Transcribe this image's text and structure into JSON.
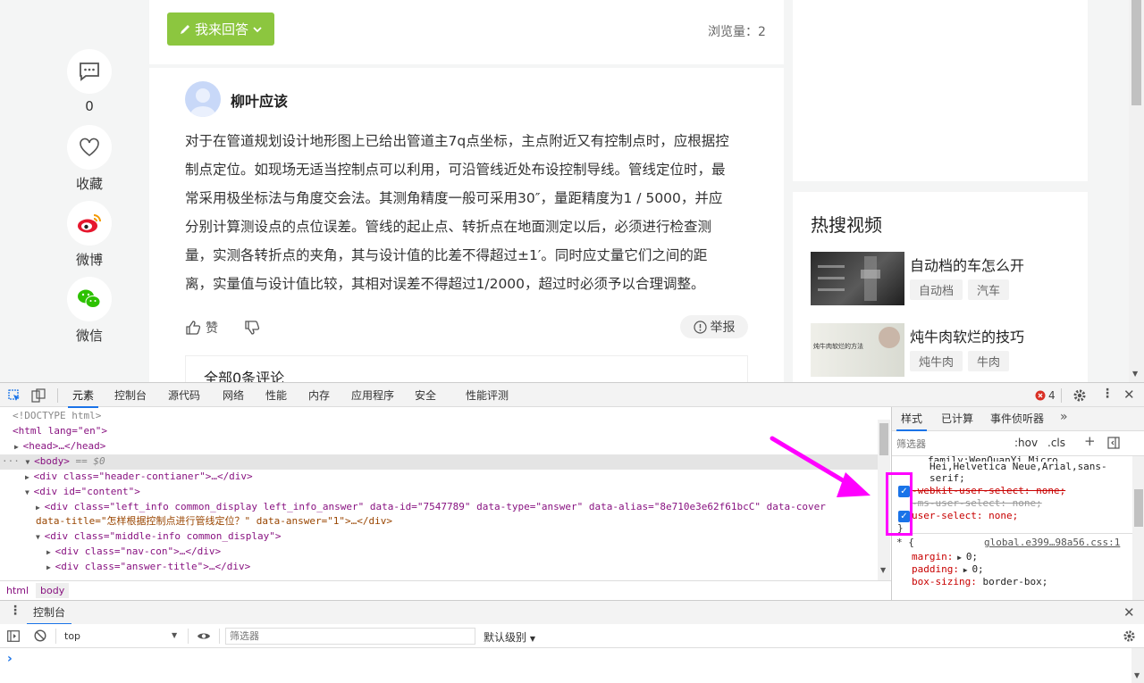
{
  "page": {
    "answer_button": "我来回答",
    "views_label": "浏览量：2",
    "side": {
      "comment_count": "0",
      "favorite": "收藏",
      "weibo": "微博",
      "wechat": "微信"
    },
    "author": "柳叶应该",
    "answer_lines": [
      "对于在管道规划设计地形图上已给出管道主7q点坐标，主点附近又有控制点时，应根据控",
      "制点定位。如现场无适当控制点可以利用，可沿管线近处布设控制导线。管线定位时，最",
      "常采用极坐标法与角度交会法。其测角精度一般可采用30″，量距精度为1 / 5000，并应",
      "分别计算测设点的点位误差。管线的起止点、转折点在地面测定以后，必须进行检查测",
      "量，实测各转折点的夹角，其与设计值的比差不得超过±1′。同时应丈量它们之间的距",
      "离，实量值与设计值比较，其相对误差不得超过1/2000，超过时必须予以合理调整。"
    ],
    "like": "赞",
    "report": "举报",
    "comments_title": "全部0条评论",
    "hot_title": "热搜视频",
    "videos": [
      {
        "title": "自动档的车怎么开",
        "tags": [
          "自动档",
          "汽车"
        ]
      },
      {
        "title": "炖牛肉软烂的技巧",
        "tags": [
          "炖牛肉",
          "牛肉"
        ],
        "thumb_text": "炖牛肉软烂的方法"
      }
    ]
  },
  "devtools": {
    "tabs": [
      "元素",
      "控制台",
      "源代码",
      "网络",
      "性能",
      "内存",
      "应用程序",
      "安全",
      "性能评测"
    ],
    "error_count": "4",
    "elements": {
      "doctype": "<!DOCTYPE html>",
      "html_open": "<html lang=\"en\">",
      "head": "<head>…</head>",
      "body": "<body>",
      "body_suffix": "== $0",
      "header_div": "<div class=\"header-contianer\">…</div>",
      "content_div": "<div id=\"content\">",
      "left_info_1": "<div class=\"left_info common_display left_info_answer\" data-id=\"7547789\" data-type=\"answer\" data-alias=\"8e710e3e62f61bcC\" data-cover",
      "left_info_2": "data-title=\"怎样根据控制点进行管线定位？\" data-answer=\"1\">…</div>",
      "middle_info": "<div class=\"middle-info common_display\">",
      "nav_con": "<div class=\"nav-con\">…</div>",
      "answer_title": "<div class=\"answer-title\">…</div>"
    },
    "breadcrumb": [
      "html",
      "body"
    ],
    "styles": {
      "tabs": [
        "样式",
        "已计算",
        "事件侦听器"
      ],
      "filter_placeholder": "筛选器",
      "hov": ":hov",
      "cls": ".cls",
      "font_partial": "family:WenQuanYi Micro",
      "font_line1": "Hei,Helvetica Neue,Arial,sans-",
      "font_line2": "serif;",
      "prop1": "-webkit-user-select: none;",
      "prop2": "-ms-user-select: none;",
      "prop3": "user-select: none;",
      "close_brace": "}",
      "rule_selector": "* {",
      "rule_source": "global.e399…98a56.css:1",
      "margin": "margin:",
      "margin_val": "0;",
      "padding": "padding:",
      "padding_val": "0;",
      "box_sizing": "box-sizing:",
      "box_sizing_val": "border-box;"
    },
    "drawer": {
      "title": "控制台",
      "context": "top",
      "filter_placeholder": "筛选器",
      "level": "默认级别",
      "prompt": "›"
    }
  },
  "colors": {
    "answer_button": "#8cc63f",
    "highlight": "#ff00ff",
    "devtools_accent": "#1a73e8"
  }
}
